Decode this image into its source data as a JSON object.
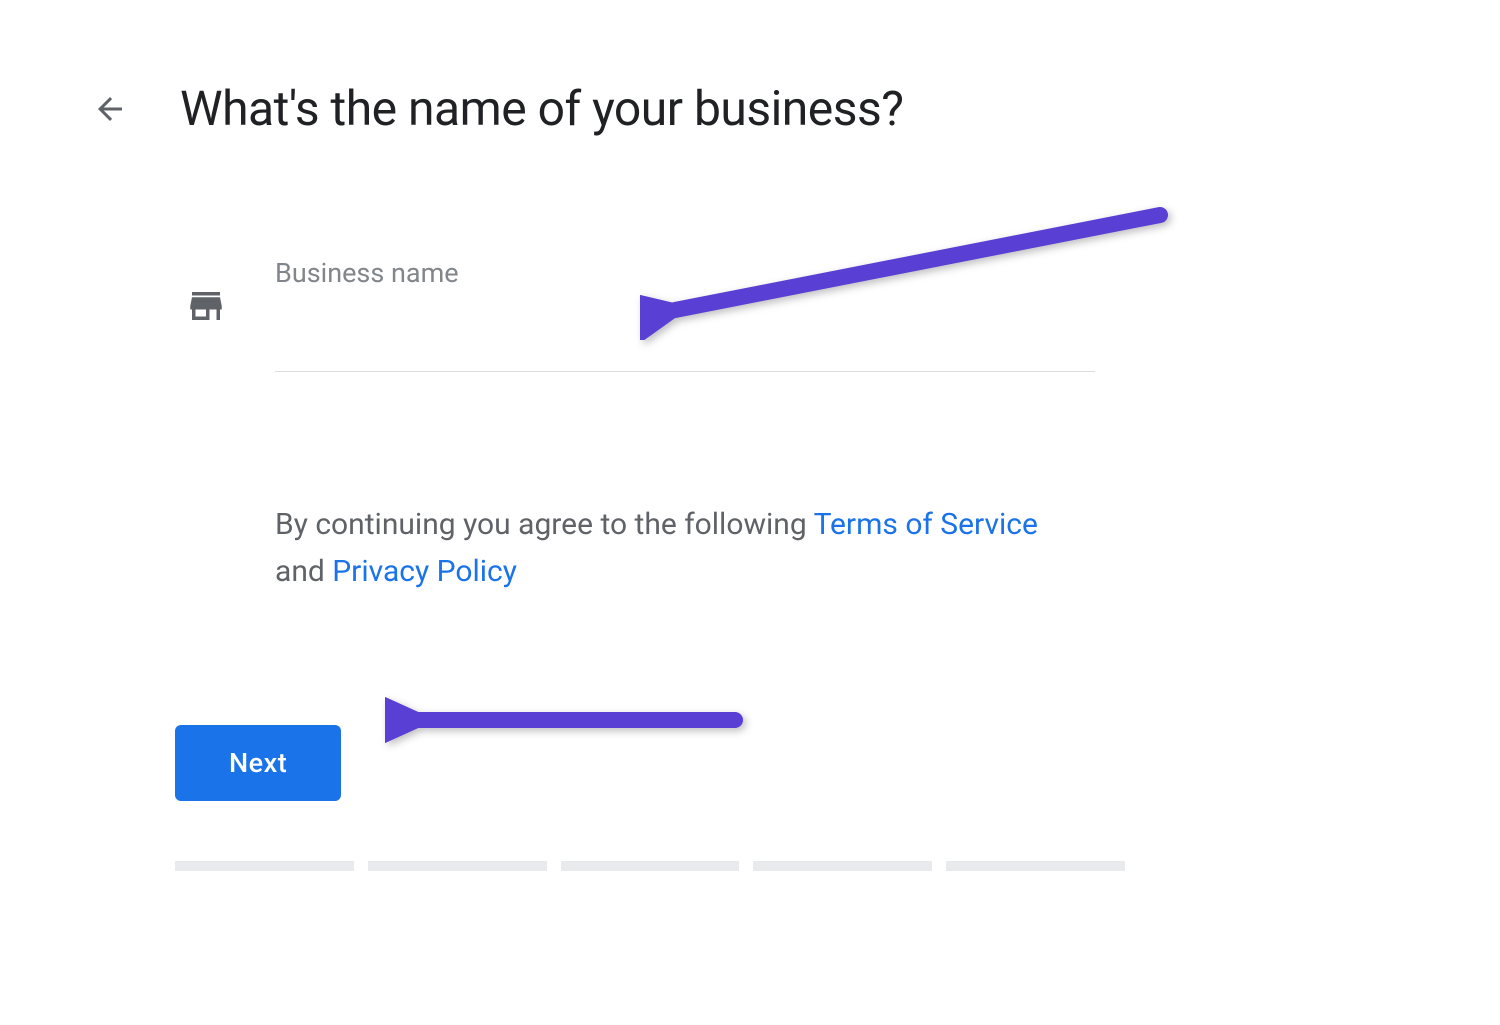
{
  "header": {
    "title": "What's the name of your business?"
  },
  "input": {
    "label": "Business name",
    "value": ""
  },
  "terms": {
    "prefix": "By continuing you agree to the following ",
    "link1": "Terms of Service",
    "middle": " and ",
    "link2": "Privacy Policy"
  },
  "actions": {
    "next_label": "Next"
  },
  "progress": {
    "steps": 5
  },
  "annotation": {
    "arrow_color": "#5a3fd4"
  }
}
